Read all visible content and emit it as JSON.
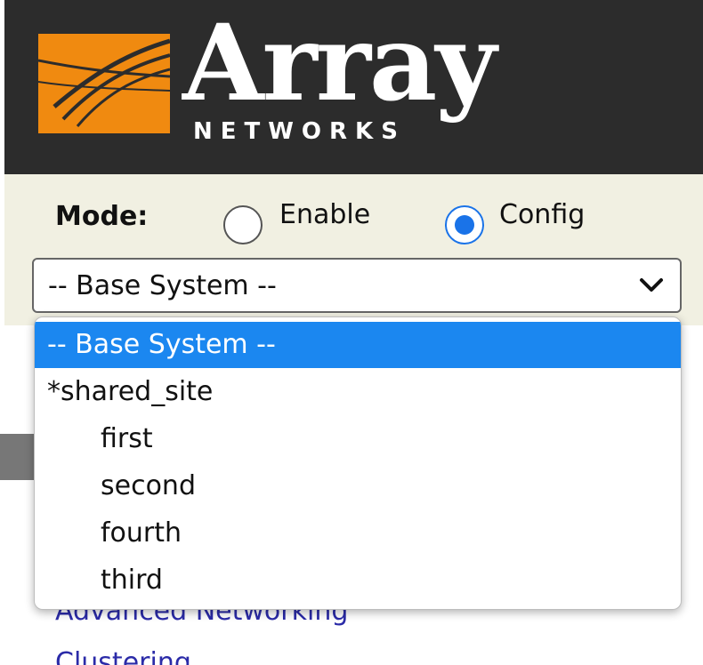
{
  "header": {
    "brand_name": "Array",
    "brand_sub": "NETWORKS",
    "brand_color": "#f08a10",
    "background": "#2c2c2c"
  },
  "mode": {
    "label": "Mode:",
    "options": [
      {
        "label": "Enable",
        "selected": false
      },
      {
        "label": "Config",
        "selected": true
      }
    ]
  },
  "site_select": {
    "value": "-- Base System --",
    "icon": "chevron-down-icon",
    "options": [
      {
        "label": "-- Base System --",
        "selected": true
      },
      {
        "label": "*shared_site",
        "selected": false
      },
      {
        "label": "first",
        "selected": false
      },
      {
        "label": "second",
        "selected": false
      },
      {
        "label": "fourth",
        "selected": false
      },
      {
        "label": "third",
        "selected": false
      }
    ]
  },
  "nav": {
    "items": [
      "Advanced Networking",
      "Clustering"
    ]
  }
}
